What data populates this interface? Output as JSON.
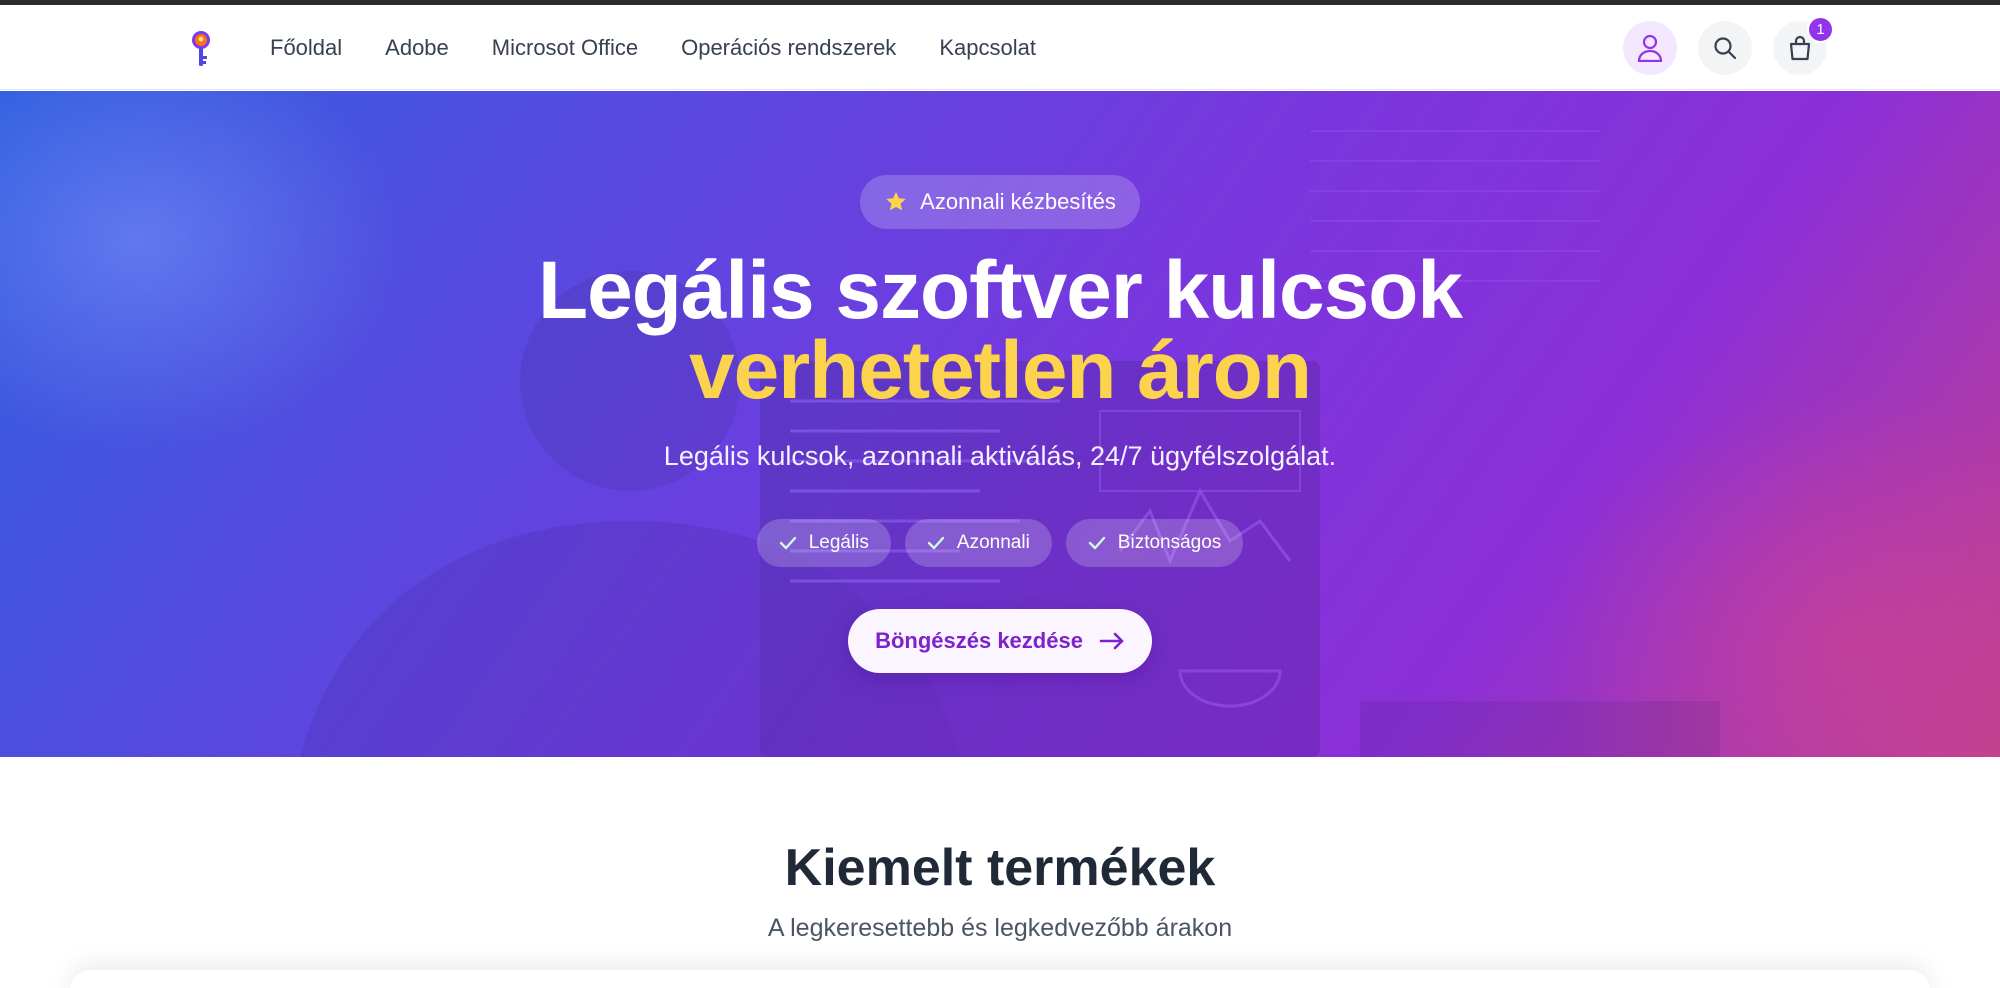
{
  "header": {
    "logo_icon": "key-icon",
    "nav": [
      {
        "label": "Főoldal"
      },
      {
        "label": "Adobe"
      },
      {
        "label": "Microsot Office"
      },
      {
        "label": "Operációs rendszerek"
      },
      {
        "label": "Kapcsolat"
      }
    ],
    "user_icon": "user-icon",
    "search_icon": "search-icon",
    "cart_icon": "shopping-bag-icon",
    "cart_count": "1"
  },
  "hero": {
    "badge": "Azonnali kézbesítés",
    "badge_icon": "star-icon",
    "title_line1": "Legális szoftver kulcsok",
    "title_line2": "verhetetlen áron",
    "subtitle": "Legális kulcsok, azonnali aktiválás, 24/7 ügyfélszolgálat.",
    "features": [
      {
        "label": "Legális"
      },
      {
        "label": "Azonnali"
      },
      {
        "label": "Biztonságos"
      }
    ],
    "cta_label": "Böngészés kezdése",
    "colors": {
      "accent": "#fcd34d",
      "brand": "#7e22ce",
      "badge": "#9333ea"
    }
  },
  "featured": {
    "title": "Kiemelt termékek",
    "subtitle": "A legkeresettebb és legkedvezőbb árakon"
  }
}
